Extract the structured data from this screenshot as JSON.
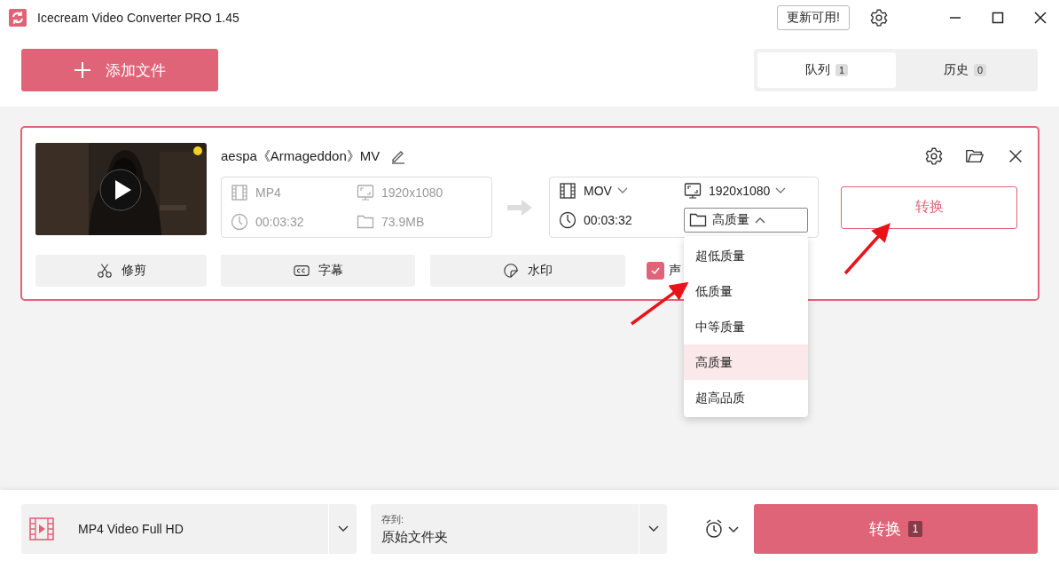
{
  "window": {
    "title": "Icecream Video Converter PRO 1.45",
    "update_button": "更新可用!"
  },
  "add_button": "添加文件",
  "tabs": [
    {
      "label": "队列",
      "count": "1",
      "selected": true
    },
    {
      "label": "历史",
      "count": "0",
      "selected": false
    }
  ],
  "queue": [
    {
      "title": "aespa《Armageddon》MV",
      "source": {
        "format": "MP4",
        "resolution": "1920x1080",
        "duration": "00:03:32",
        "size": "73.9MB"
      },
      "output": {
        "format": "MOV",
        "resolution": "1920x1080",
        "duration": "00:03:32",
        "quality": "高质量",
        "quality_open": true
      },
      "convert_button": "转换",
      "tools": [
        {
          "kind": "trim",
          "label": "修剪"
        },
        {
          "kind": "subtitles",
          "label": "字幕"
        },
        {
          "kind": "watermark",
          "label": "水印"
        }
      ],
      "audio": {
        "label": "声",
        "checked": true
      }
    }
  ],
  "quality_menu": [
    {
      "label": "超低质量",
      "selected": false
    },
    {
      "label": "低质量",
      "selected": false
    },
    {
      "label": "中等质量",
      "selected": false
    },
    {
      "label": "高质量",
      "selected": true
    },
    {
      "label": "超高品质",
      "selected": false
    }
  ],
  "bottom": {
    "preset": "MP4 Video Full HD",
    "save_label": "存到:",
    "save_folder": "原始文件夹",
    "convert_button": "转换",
    "count": "1"
  }
}
